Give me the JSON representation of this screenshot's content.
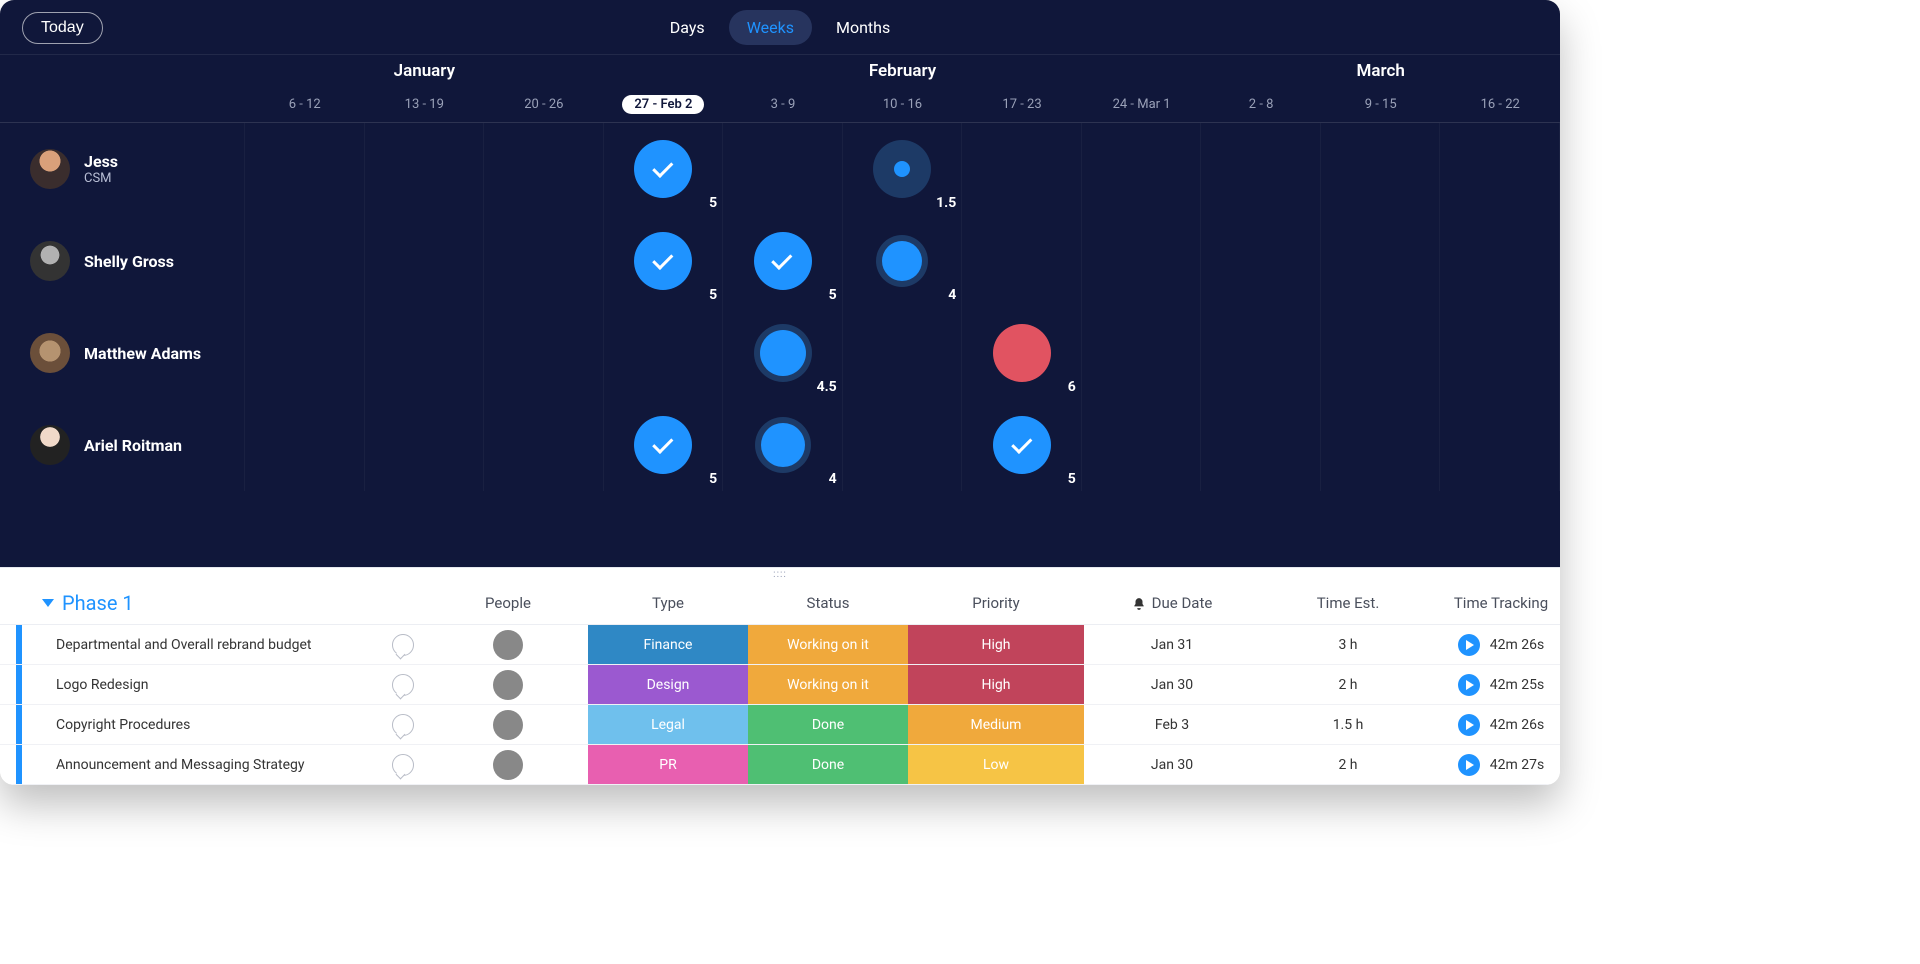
{
  "header": {
    "today": "Today",
    "views": {
      "days": "Days",
      "weeks": "Weeks",
      "months": "Months",
      "active": "weeks"
    }
  },
  "months": {
    "jan": "January",
    "feb": "February",
    "mar": "March"
  },
  "weeks": [
    {
      "label": "6 - 12"
    },
    {
      "label": "13 - 19"
    },
    {
      "label": "20 - 26"
    },
    {
      "label": "27 - Feb 2",
      "current": true
    },
    {
      "label": "3 - 9"
    },
    {
      "label": "10 - 16"
    },
    {
      "label": "17 - 23"
    },
    {
      "label": "24 - Mar 1"
    },
    {
      "label": "2 - 8"
    },
    {
      "label": "9 - 15"
    },
    {
      "label": "16 - 22"
    }
  ],
  "people": [
    {
      "name": "Jess",
      "role": "CSM",
      "avatar": "av-jess",
      "cells": [
        null,
        null,
        null,
        {
          "kind": "check",
          "size": 58,
          "bg": "#1f93ff",
          "label": "5"
        },
        null,
        {
          "kind": "halo-dot",
          "size": 58,
          "bg": "#1d3a66",
          "label": "1.5"
        },
        null,
        null,
        null,
        null,
        null
      ]
    },
    {
      "name": "Shelly Gross",
      "role": "",
      "avatar": "av-shelly",
      "cells": [
        null,
        null,
        null,
        {
          "kind": "check",
          "size": 58,
          "bg": "#1f93ff",
          "label": "5"
        },
        {
          "kind": "check",
          "size": 58,
          "bg": "#1f93ff",
          "label": "5"
        },
        {
          "kind": "halo",
          "size": 52,
          "bg": "#1d3a66",
          "inner": "#1f93ff",
          "label": "4"
        },
        null,
        null,
        null,
        null,
        null
      ]
    },
    {
      "name": "Matthew Adams",
      "role": "",
      "avatar": "av-matt",
      "cells": [
        null,
        null,
        null,
        null,
        {
          "kind": "halo",
          "size": 58,
          "bg": "#1d3a66",
          "inner": "#1f93ff",
          "label": "4.5"
        },
        null,
        {
          "kind": "plain",
          "size": 58,
          "bg": "#e15361",
          "label": "6"
        },
        null,
        null,
        null,
        null
      ]
    },
    {
      "name": "Ariel Roitman",
      "role": "",
      "avatar": "av-ariel",
      "cells": [
        null,
        null,
        null,
        {
          "kind": "check",
          "size": 58,
          "bg": "#1f93ff",
          "label": "5"
        },
        {
          "kind": "halo",
          "size": 56,
          "bg": "#1d3a66",
          "inner": "#1f93ff",
          "label": "4"
        },
        null,
        {
          "kind": "check",
          "size": 58,
          "bg": "#1f93ff",
          "label": "5"
        },
        null,
        null,
        null,
        null
      ]
    }
  ],
  "phase": {
    "title": "Phase 1"
  },
  "columns": {
    "people": "People",
    "type": "Type",
    "status": "Status",
    "priority": "Priority",
    "due": "Due Date",
    "est": "Time Est.",
    "track": "Time Tracking"
  },
  "rows": [
    {
      "task": "Departmental and Overall rebrand budget",
      "avatar": "av-jess",
      "type": {
        "label": "Finance",
        "bg": "#2f88c5"
      },
      "status": {
        "label": "Working on it",
        "bg": "#f0a93c"
      },
      "priority": {
        "label": "High",
        "bg": "#c1445b"
      },
      "due": "Jan 31",
      "est": "3 h",
      "track": "42m 26s"
    },
    {
      "task": "Logo Redesign",
      "avatar": "av-shelly",
      "type": {
        "label": "Design",
        "bg": "#9b59d0"
      },
      "status": {
        "label": "Working on it",
        "bg": "#f0a93c"
      },
      "priority": {
        "label": "High",
        "bg": "#c1445b"
      },
      "due": "Jan 30",
      "est": "2 h",
      "track": "42m 25s"
    },
    {
      "task": "Copyright Procedures",
      "avatar": "av-matt",
      "type": {
        "label": "Legal",
        "bg": "#6fc0ed"
      },
      "status": {
        "label": "Done",
        "bg": "#4fbf73"
      },
      "priority": {
        "label": "Medium",
        "bg": "#f0a93c"
      },
      "due": "Feb 3",
      "est": "1.5 h",
      "track": "42m 26s"
    },
    {
      "task": "Announcement and Messaging Strategy",
      "avatar": "av-unknown",
      "type": {
        "label": "PR",
        "bg": "#e85fb0"
      },
      "status": {
        "label": "Done",
        "bg": "#4fbf73"
      },
      "priority": {
        "label": "Low",
        "bg": "#f6c445"
      },
      "due": "Jan 30",
      "est": "2 h",
      "track": "42m 27s"
    }
  ]
}
